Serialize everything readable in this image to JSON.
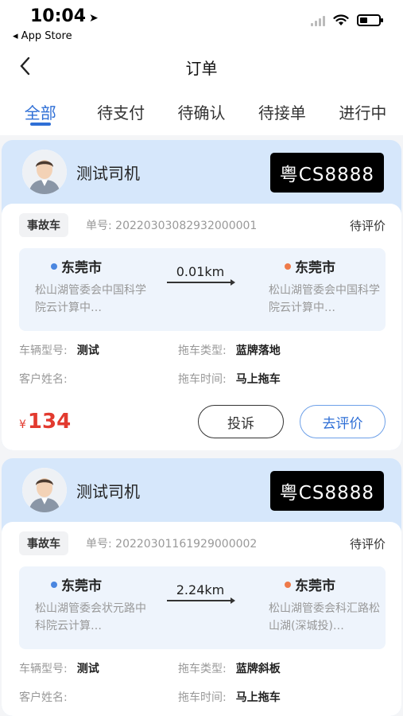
{
  "status_bar": {
    "time": "10:04",
    "back_app": "App Store"
  },
  "nav": {
    "title": "订单"
  },
  "tabs": [
    {
      "label": "全部",
      "active": true
    },
    {
      "label": "待支付",
      "active": false
    },
    {
      "label": "待确认",
      "active": false
    },
    {
      "label": "待接单",
      "active": false
    },
    {
      "label": "进行中",
      "active": false
    }
  ],
  "orders": [
    {
      "driver_name": "测试司机",
      "plate": "粤CS8888",
      "tag": "事故车",
      "order_no_label": "单号:",
      "order_no": "20220303082932000001",
      "status": "待评价",
      "start_city": "东莞市",
      "start_address": "松山湖管委会中国科学院云计算中…",
      "distance": "0.01km",
      "end_city": "东莞市",
      "end_address": "松山湖管委会中国科学院云计算中…",
      "vehicle_model_label": "车辆型号:",
      "vehicle_model": "测试",
      "tow_type_label": "拖车类型:",
      "tow_type": "蓝牌落地",
      "customer_label": "客户姓名:",
      "customer_name": "",
      "tow_time_label": "拖车时间:",
      "tow_time": "马上拖车",
      "currency": "¥",
      "price": "134",
      "complain_label": "投诉",
      "review_label": "去评价"
    },
    {
      "driver_name": "测试司机",
      "plate": "粤CS8888",
      "tag": "事故车",
      "order_no_label": "单号:",
      "order_no": "20220301161929000002",
      "status": "待评价",
      "start_city": "东莞市",
      "start_address": "松山湖管委会状元路中科院云计算…",
      "distance": "2.24km",
      "end_city": "东莞市",
      "end_address": "松山湖管委会科汇路松山湖(深城投)…",
      "vehicle_model_label": "车辆型号:",
      "vehicle_model": "测试",
      "tow_type_label": "拖车类型:",
      "tow_type": "蓝牌斜板",
      "customer_label": "客户姓名:",
      "customer_name": "",
      "tow_time_label": "拖车时间:",
      "tow_time": "马上拖车"
    }
  ],
  "colors": {
    "accent": "#2f6fd6",
    "price": "#e23a2f",
    "card_header": "#d6e7fb",
    "start_dot": "#4a86e0",
    "end_dot": "#ee7a4a"
  }
}
